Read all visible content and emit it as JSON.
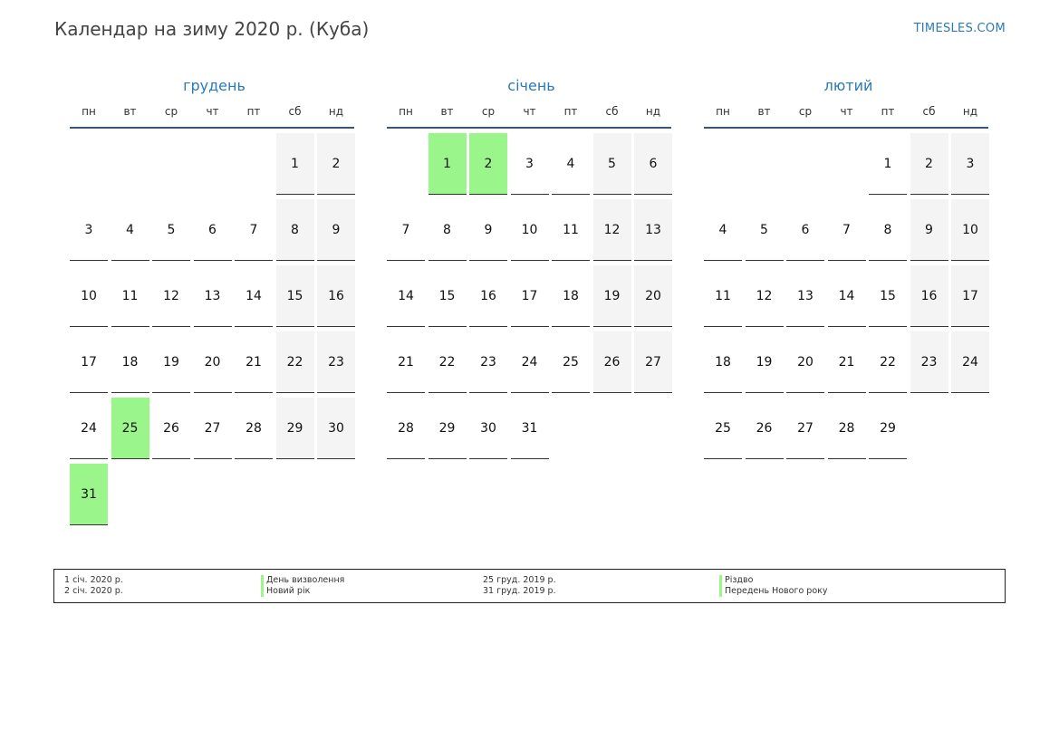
{
  "header": {
    "title": "Календар на зиму 2020 р. (Куба)",
    "brand": "TIMESLES.COM"
  },
  "weekdays": [
    "пн",
    "вт",
    "ср",
    "чт",
    "пт",
    "сб",
    "нд"
  ],
  "colors": {
    "accent": "#2a7ab8",
    "holiday": "#9af58a",
    "weekend": "#f4f4f4"
  },
  "months": [
    {
      "name": "грудень",
      "first_weekday": 6,
      "days": 31,
      "holidays": [
        25,
        31
      ]
    },
    {
      "name": "січень",
      "first_weekday": 2,
      "days": 31,
      "holidays": [
        1,
        2
      ]
    },
    {
      "name": "лютий",
      "first_weekday": 5,
      "days": 29,
      "holidays": []
    }
  ],
  "legend": [
    {
      "date": "1 січ. 2020 р.",
      "name": "День визволення"
    },
    {
      "date": "2 січ. 2020 р.",
      "name": "Новий рік"
    },
    {
      "date": "25 груд. 2019 р.",
      "name": "Різдво"
    },
    {
      "date": "31 груд. 2019 р.",
      "name": "Передень Нового року"
    }
  ]
}
